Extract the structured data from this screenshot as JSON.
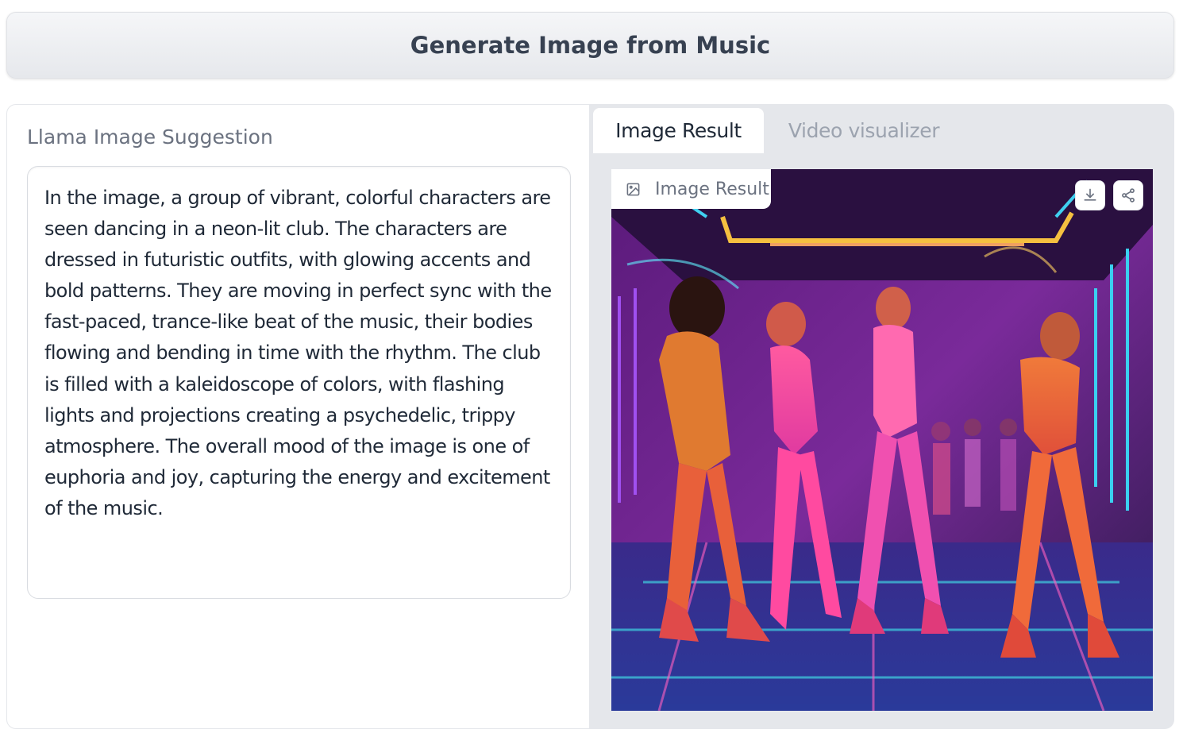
{
  "header": {
    "generate_label": "Generate Image from Music"
  },
  "suggestion": {
    "label": "Llama Image Suggestion",
    "text": "In the image, a group of vibrant, colorful characters are seen dancing in a neon-lit club. The characters are dressed in futuristic outfits, with glowing accents and bold patterns. They are moving in perfect sync with the fast-paced, trance-like beat of the music, their bodies flowing and bending in time with the rhythm. The club is filled with a kaleidoscope of colors, with flashing lights and projections creating a psychedelic, trippy atmosphere. The overall mood of the image is one of euphoria and joy, capturing the energy and excitement of the music."
  },
  "tabs": [
    {
      "label": "Image Result",
      "active": true
    },
    {
      "label": "Video visualizer",
      "active": false
    }
  ],
  "result": {
    "label": "Image Result",
    "icons": [
      "image-icon",
      "download-icon",
      "share-icon"
    ]
  },
  "colors": {
    "accent_text": "#374151",
    "muted": "#6b7280",
    "inactive_tab": "#9ca3af",
    "panel_bg": "#e5e7eb"
  }
}
